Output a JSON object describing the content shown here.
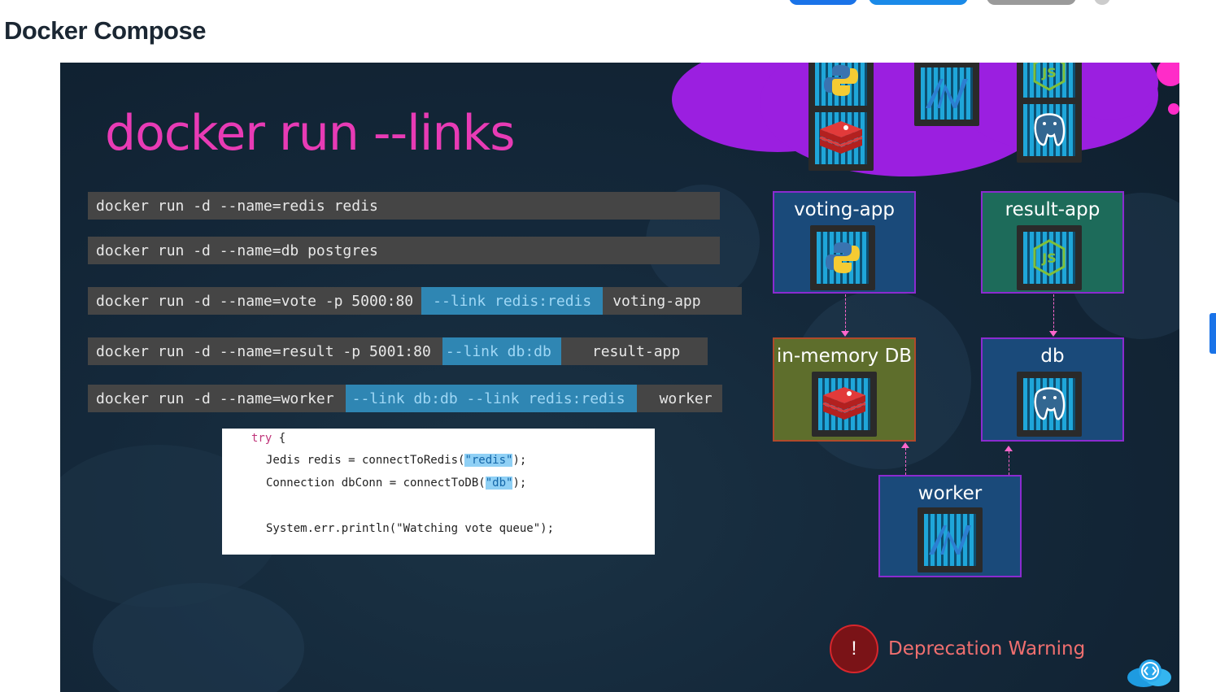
{
  "page": {
    "title": "Docker Compose"
  },
  "slide": {
    "title": "docker run --links",
    "commands": [
      {
        "base": "docker run -d --name=redis redis"
      },
      {
        "base": "docker run -d --name=db postgres"
      },
      {
        "base": "docker run -d --name=vote -p 5000:80",
        "link": "--link redis:redis",
        "image": "voting-app"
      },
      {
        "base": "docker run -d --name=result -p 5001:80",
        "link": "--link db:db",
        "image": "result-app"
      },
      {
        "base": "docker run -d --name=worker",
        "link": "--link db:db --link redis:redis",
        "image": "worker"
      }
    ],
    "code": {
      "try_kw": "try",
      "try_brace": " {",
      "line1_prefix": "Jedis redis = connectToRedis(",
      "line1_arg": "\"redis\"",
      "line1_suffix": ");",
      "line2_prefix": "Connection dbConn = connectToDB(",
      "line2_arg": "\"db\"",
      "line2_suffix": ");",
      "line3": "System.err.println(\"Watching vote queue\");"
    },
    "diagram": {
      "services": [
        {
          "label": "voting-app",
          "icon": "python-icon",
          "bg": "#1a4a7a"
        },
        {
          "label": "result-app",
          "icon": "nodejs-icon",
          "bg": "#1d6b5a"
        },
        {
          "label": "in-memory DB",
          "icon": "redis-icon",
          "bg": "#5e6e2c"
        },
        {
          "label": "db",
          "icon": "postgres-icon",
          "bg": "#1a4a7a"
        },
        {
          "label": "worker",
          "icon": "dotnet-icon",
          "bg": "#1a4a7a"
        }
      ]
    },
    "warning": {
      "icon": "!",
      "text": "Deprecation Warning"
    },
    "colors": {
      "accent": "#e83bb5",
      "link_bg": "#2f86b3",
      "cloud": "#9b1fe0",
      "warning": "#f06f6f"
    }
  }
}
